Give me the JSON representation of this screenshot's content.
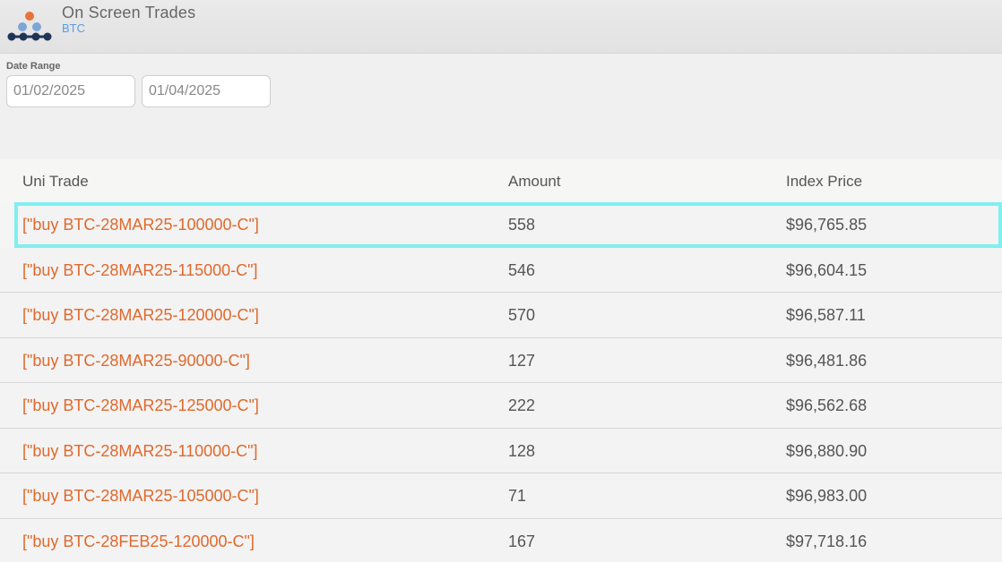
{
  "app": {
    "title": "On Screen Trades",
    "subtitle": "BTC"
  },
  "filters": {
    "date_range_label": "Date Range",
    "start_date": "01/02/2025",
    "end_date": "01/04/2025"
  },
  "table": {
    "columns": [
      "Uni Trade",
      "Amount",
      "Index Price"
    ],
    "rows": [
      {
        "trade": "[\"buy BTC-28MAR25-100000-C\"]",
        "amount": "558",
        "index_price": "$96,765.85"
      },
      {
        "trade": "[\"buy BTC-28MAR25-115000-C\"]",
        "amount": "546",
        "index_price": "$96,604.15"
      },
      {
        "trade": "[\"buy BTC-28MAR25-120000-C\"]",
        "amount": "570",
        "index_price": "$96,587.11"
      },
      {
        "trade": "[\"buy BTC-28MAR25-90000-C\"]",
        "amount": "127",
        "index_price": "$96,481.86"
      },
      {
        "trade": "[\"buy BTC-28MAR25-125000-C\"]",
        "amount": "222",
        "index_price": "$96,562.68"
      },
      {
        "trade": "[\"buy BTC-28MAR25-110000-C\"]",
        "amount": "128",
        "index_price": "$96,880.90"
      },
      {
        "trade": "[\"buy BTC-28MAR25-105000-C\"]",
        "amount": "71",
        "index_price": "$96,983.00"
      },
      {
        "trade": "[\"buy BTC-28FEB25-120000-C\"]",
        "amount": "167",
        "index_price": "$97,718.16"
      }
    ]
  },
  "colors": {
    "trade_link": "#e0692c",
    "subtitle": "#5b9be6",
    "selection_outline": "#7ef0ef",
    "logo_orange": "#e8733a",
    "logo_blue": "#7da6d6",
    "logo_navy": "#1f3557"
  }
}
